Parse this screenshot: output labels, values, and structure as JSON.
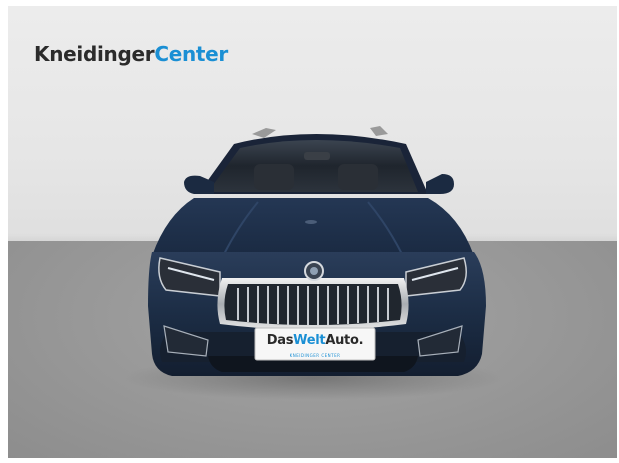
{
  "brand": {
    "name_part1": "Kneidinger",
    "name_part2": "Center",
    "color_dark": "#2b2b2b",
    "color_accent": "#1a8fd4"
  },
  "plate": {
    "part1": "Das",
    "part2": "Welt",
    "part3": "Auto.",
    "dealer_line": "KNEIDINGER CENTER"
  },
  "car": {
    "body_color": "#1c2d45"
  }
}
